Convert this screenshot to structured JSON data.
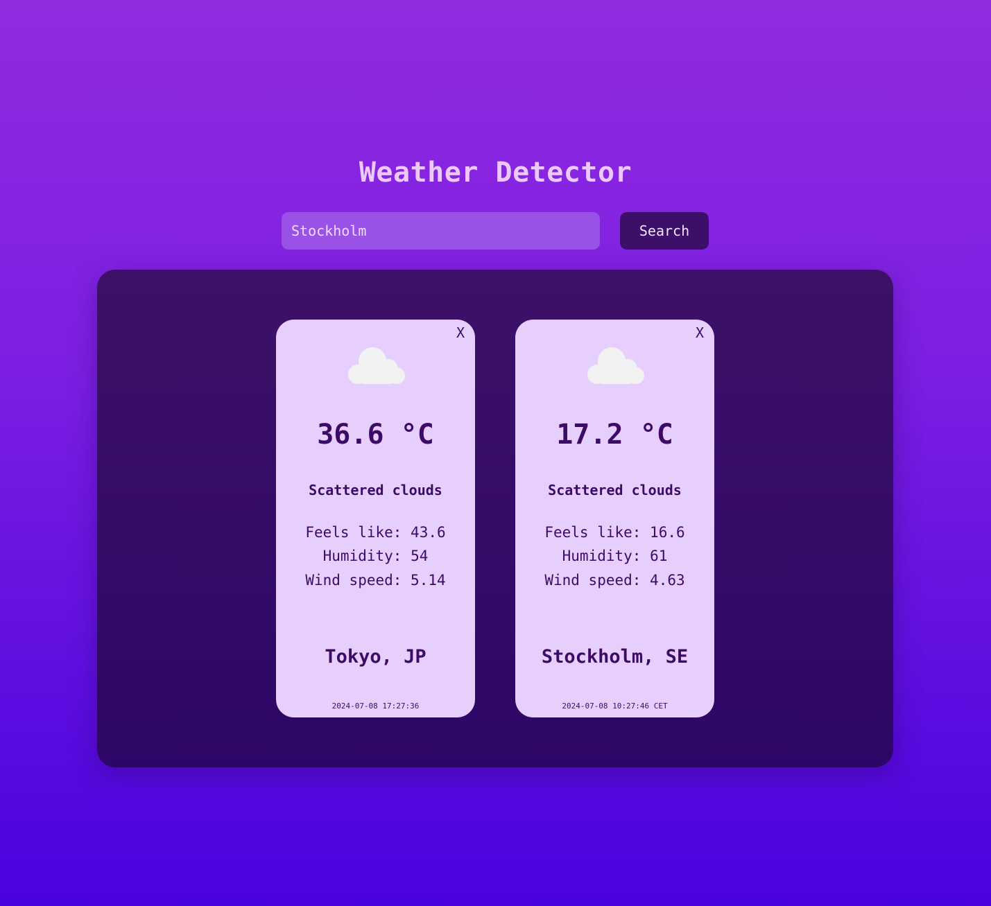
{
  "app": {
    "title": "Weather Detector"
  },
  "search": {
    "value": "Stockholm",
    "placeholder": "Stockholm",
    "button_label": "Search"
  },
  "cards": [
    {
      "close_label": "X",
      "icon": "cloud-icon",
      "temperature": "36.6 °C",
      "description": "Scattered clouds",
      "feels_like": "Feels like: 43.6",
      "humidity": "Humidity: 54",
      "wind_speed": "Wind speed: 5.14",
      "location": "Tokyo, JP",
      "timestamp": "2024-07-08 17:27:36"
    },
    {
      "close_label": "X",
      "icon": "cloud-icon",
      "temperature": "17.2 °C",
      "description": "Scattered clouds",
      "feels_like": "Feels like: 16.6",
      "humidity": "Humidity: 61",
      "wind_speed": "Wind speed: 4.63",
      "location": "Stockholm, SE",
      "timestamp": "2024-07-08 10:27:46 CET"
    }
  ],
  "colors": {
    "background_top": "#922ae0",
    "background_bottom": "#4a02dd",
    "panel": "#320b68",
    "card": "#e6cffc",
    "text_dark": "#3d0a66",
    "button": "#3c1068",
    "input": "#9a52e6",
    "title": "#ecc9fb",
    "cloud": "#f2f2f2"
  }
}
